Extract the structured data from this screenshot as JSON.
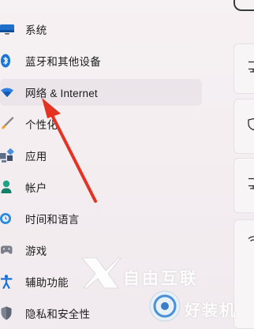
{
  "nav": {
    "items": [
      {
        "label": "系统",
        "icon": "monitor-icon",
        "selected": false
      },
      {
        "label": "蓝牙和其他设备",
        "icon": "bluetooth-icon",
        "selected": false
      },
      {
        "label": "网络 & Internet",
        "icon": "wifi-icon",
        "selected": true
      },
      {
        "label": "个性化",
        "icon": "paintbrush-icon",
        "selected": false
      },
      {
        "label": "应用",
        "icon": "apps-icon",
        "selected": false
      },
      {
        "label": "帐户",
        "icon": "account-icon",
        "selected": false
      },
      {
        "label": "时间和语言",
        "icon": "globe-clock-icon",
        "selected": false
      },
      {
        "label": "游戏",
        "icon": "gamepad-icon",
        "selected": false
      },
      {
        "label": "辅助功能",
        "icon": "accessibility-icon",
        "selected": false
      },
      {
        "label": "隐私和安全性",
        "icon": "shield-icon",
        "selected": false
      }
    ]
  },
  "watermark": {
    "line1": "自由互联",
    "line2": "好装机"
  },
  "colors": {
    "accent": "#0067c0",
    "annotation_arrow": "#e53323",
    "selected_bg": "#ebe5e9"
  }
}
